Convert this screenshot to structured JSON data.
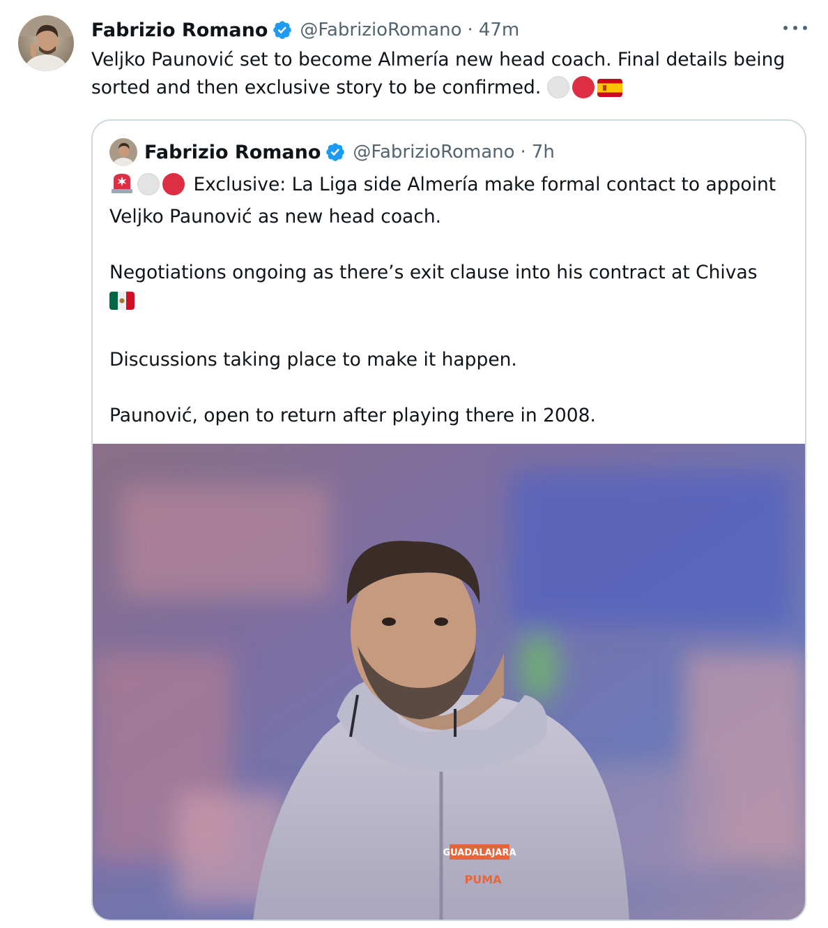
{
  "tweet": {
    "author_name": "Fabrizio Romano",
    "handle": "@FabrizioRomano",
    "separator": "·",
    "time": "47m",
    "text": "Veljko Paunović set to become Almería new head coach. Final details being sorted and then exclusive story to be confirmed.",
    "text_emojis": [
      "white-circle",
      "red-circle",
      "flag-spain"
    ]
  },
  "quoted": {
    "author_name": "Fabrizio Romano",
    "handle": "@FabrizioRomano",
    "separator": "·",
    "time": "7h",
    "paragraph1": "Exclusive: La Liga side Almería make formal contact to appoint Veljko Paunović as new head coach.",
    "paragraph2": "Negotiations ongoing as there’s exit clause into his contract at Chivas",
    "paragraph3": "Discussions taking place to make it happen.",
    "paragraph4": "Paunović, open to return after playing there in 2008.",
    "media": {
      "jacket_text": "GUADALAJARA",
      "brand_text": "PUMA"
    }
  },
  "colors": {
    "text": "#0f1419",
    "secondary": "#536471",
    "verified": "#1d9bf0",
    "border": "#cfd9de"
  }
}
